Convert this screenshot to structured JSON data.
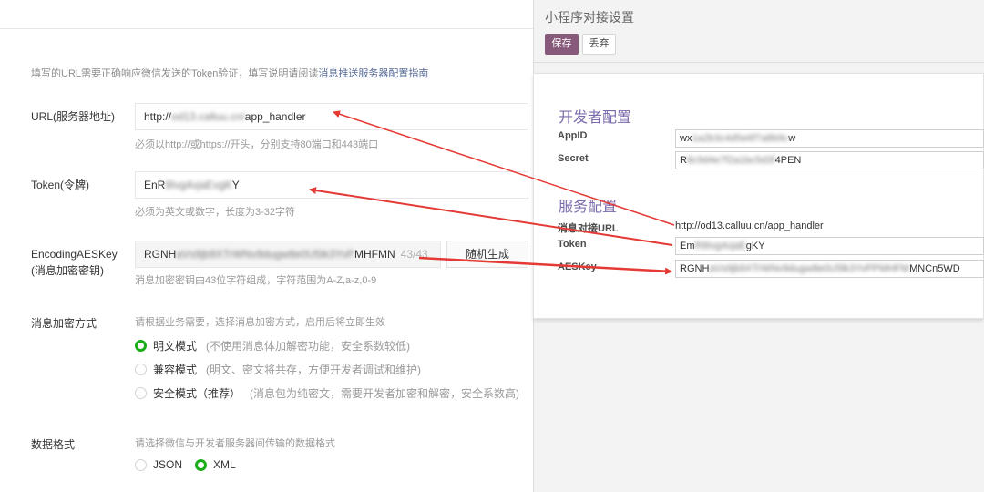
{
  "left": {
    "tip_text": "填写的URL需要正确响应微信发送的Token验证，填写说明请阅读",
    "tip_link": "消息推送服务器配置指南",
    "url": {
      "label": "URL(服务器地址)",
      "value_prefix": "http://",
      "value_blurred": "od13.calluu.cn/",
      "value_suffix": "app_handler",
      "hint": "必须以http://或https://开头，分别支持80端口和443端口"
    },
    "token": {
      "label": "Token(令牌)",
      "value_prefix": "EnR",
      "value_blurred": "8Ivg4vjaEvgK",
      "value_suffix": "Y",
      "hint": "必须为英文或数字，长度为3-32字符"
    },
    "aeskey": {
      "label_line1": "EncodingAESKey",
      "label_line2": "(消息加密密钥)",
      "value_prefix": "RGNH",
      "value_blurred": "aVs9jb9XTrWNv9dugw8e0U5lk3YvP",
      "value_suffix": "MHFMN",
      "counter": "43/43",
      "random_button": "随机生成",
      "hint": "消息加密密钥由43位字符组成，字符范围为A-Z,a-z,0-9"
    },
    "encrypt": {
      "label": "消息加密方式",
      "hint": "请根据业务需要，选择消息加密方式，启用后将立即生效",
      "options": [
        {
          "name": "明文模式",
          "desc": "(不使用消息体加解密功能，安全系数较低)",
          "selected": true
        },
        {
          "name": "兼容模式",
          "desc": "(明文、密文将共存，方便开发者调试和维护)",
          "selected": false
        },
        {
          "name": "安全模式（推荐）",
          "desc": "(消息包为纯密文，需要开发者加密和解密，安全系数高)",
          "selected": false
        }
      ]
    },
    "format": {
      "label": "数据格式",
      "hint": "请选择微信与开发者服务器间传输的数据格式",
      "options": [
        {
          "name": "JSON",
          "selected": false
        },
        {
          "name": "XML",
          "selected": true
        }
      ]
    }
  },
  "dialog": {
    "title": "小程序对接设置",
    "save": "保存",
    "discard": "丢弃",
    "dev_section": "开发者配置",
    "appid_label": "AppID",
    "appid_prefix": "wx",
    "appid_blurred": "1a2b3c4d5e6f7a8b9c",
    "appid_suffix": "w",
    "secret_label": "Secret",
    "secret_prefix": "R",
    "secret_blurred": "8c9d4e7f2a1bc5d3f",
    "secret_suffix": "4PEN",
    "service_section": "服务配置",
    "url_label": "消息对接URL",
    "url_value": "http://od13.calluu.cn/app_handler",
    "token_label": "Token",
    "token_prefix": "Em",
    "token_blurred": "R8Ivg4vjaE",
    "token_suffix": "gKY",
    "aes_label": "AESKey",
    "aes_prefix": "RGNH",
    "aes_blurred": "aVs9jb9XTrWNv9dugw8e0U5lk3YvPPMHFM",
    "aes_suffix": "MNCn5WD"
  },
  "colors": {
    "accent_green": "#1aad19",
    "link": "#576b95",
    "save_button": "#875a7b",
    "section_title": "#7c6bab",
    "arrow": "#e53935"
  }
}
